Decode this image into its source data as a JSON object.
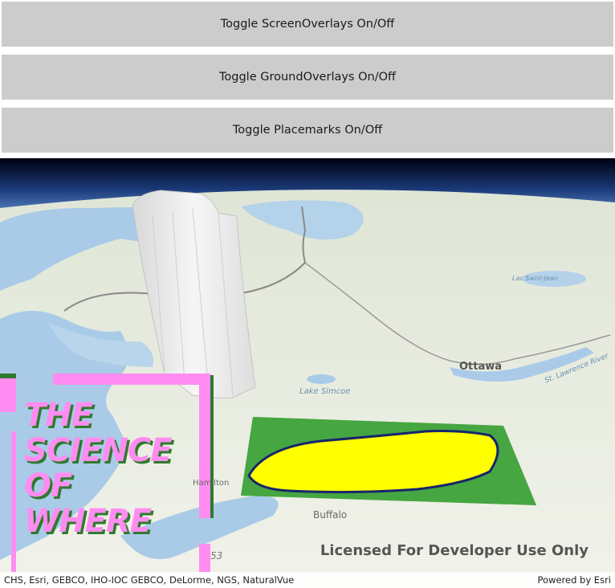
{
  "buttons": {
    "screen_overlays": "Toggle ScreenOverlays On/Off",
    "ground_overlays": "Toggle GroundOverlays On/Off",
    "placemarks": "Toggle Placemarks On/Off"
  },
  "map": {
    "labels": {
      "ottawa": "Ottawa",
      "lake_simcoe": "Lake Simcoe",
      "buffalo": "Buffalo",
      "hamilton": "Hamilton",
      "st_lawrence": "St. Lawrence River",
      "lac_saint_jean": "Lac Saint-Jean",
      "route_number": "53"
    },
    "screen_overlay_text": [
      "THE",
      "SCIENCE",
      "OF",
      "WHERE"
    ],
    "watermark": "Licensed For Developer Use Only",
    "attribution": "CHS, Esri, GEBCO, IHO-IOC GEBCO, DeLorme, NGS, NaturalVue",
    "powered_by": "Powered by Esri",
    "colors": {
      "button_bg": "#cccccc",
      "overlay_pink": "#ff8cf0",
      "overlay_green": "#2f7a2f",
      "lake_yellow": "#ffff00",
      "water": "#a9cbe8",
      "land": "#e8eddc",
      "sky_top": "#000010"
    }
  }
}
